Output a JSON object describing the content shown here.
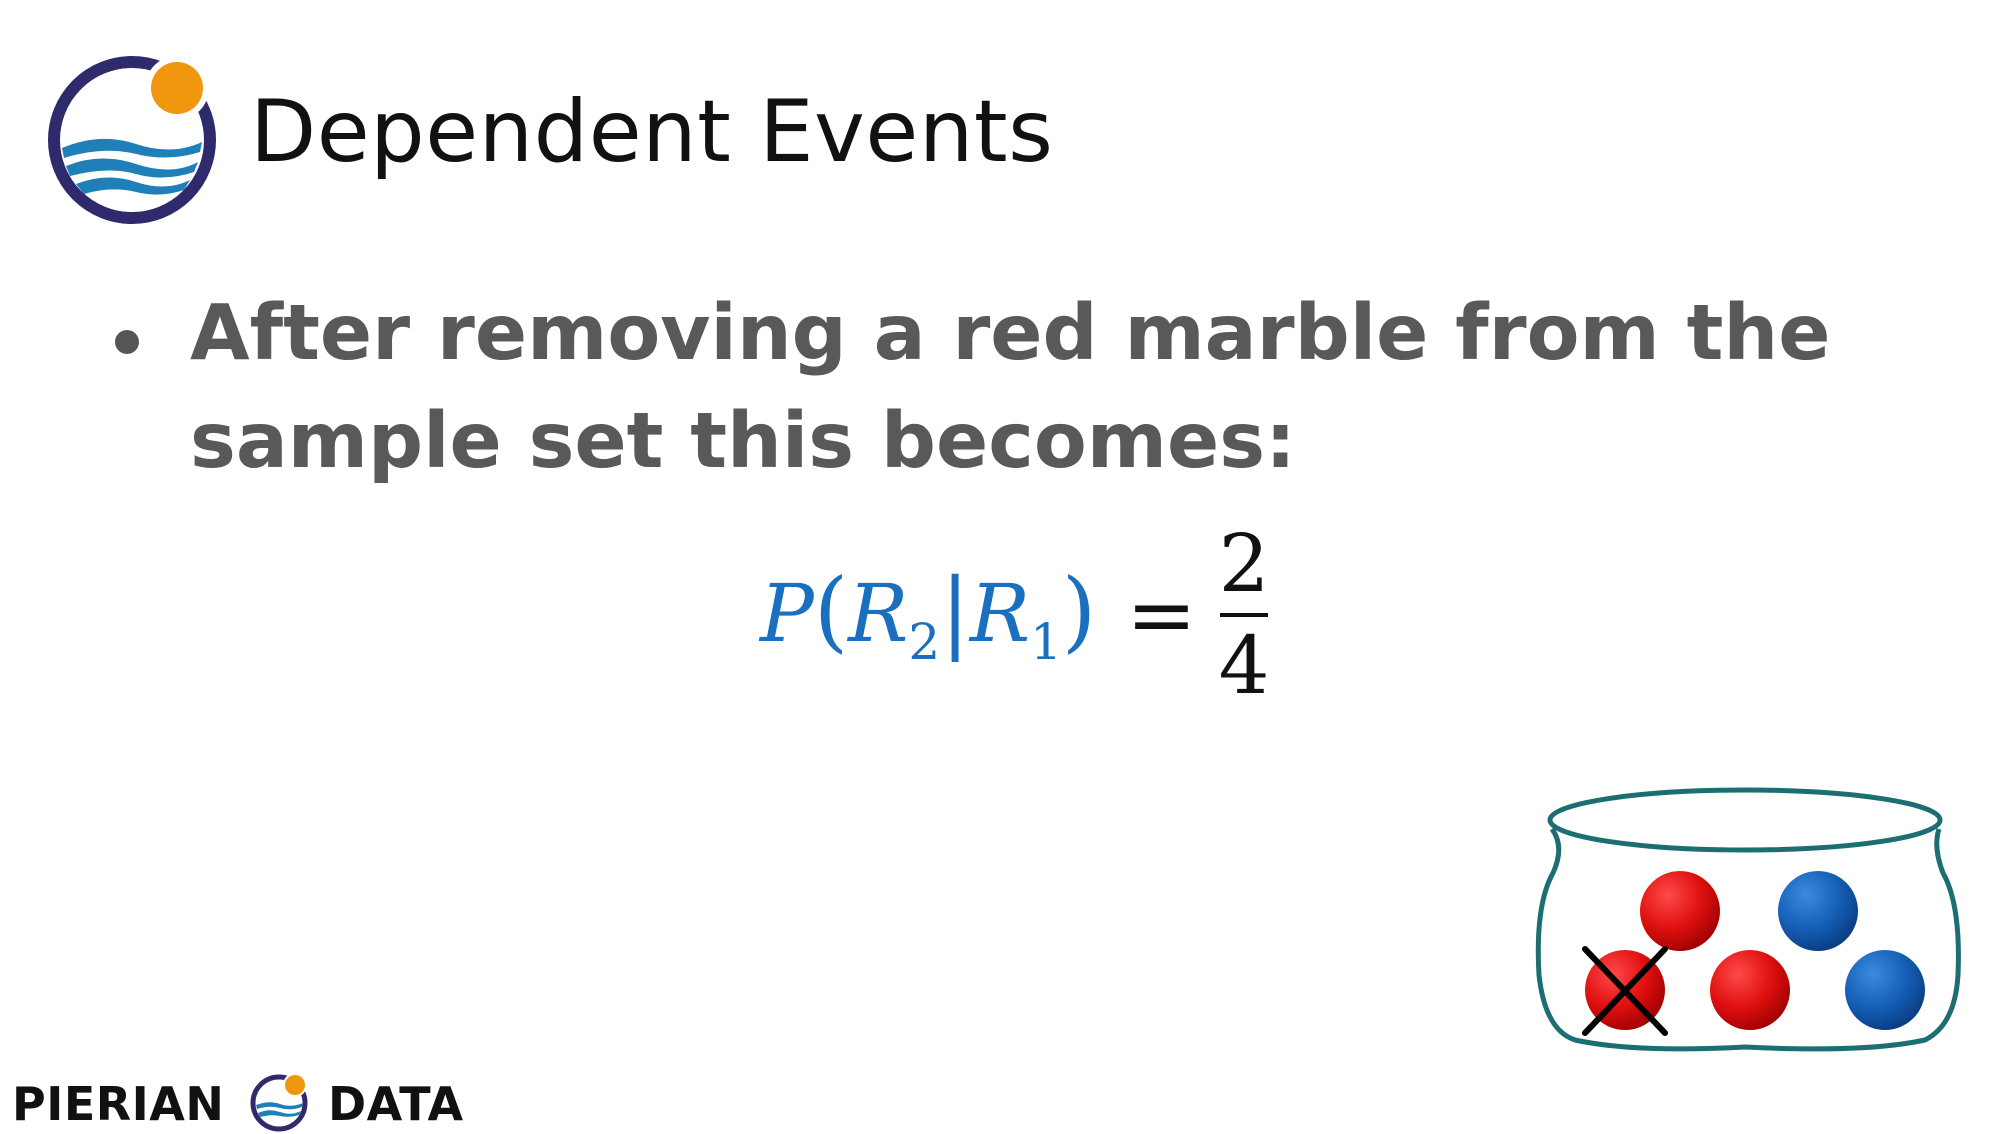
{
  "slide": {
    "title": "Dependent Events",
    "bullet_lines": [
      "After removing a red marble from the",
      "sample set this becomes:"
    ]
  },
  "formula": {
    "P": "P",
    "open_paren": "(",
    "R2_letter": "R",
    "R2_sub": "2",
    "pipe": "|",
    "R1_letter": "R",
    "R1_sub": "1",
    "close_paren": ")",
    "equals": "=",
    "numerator": "2",
    "denominator": "4"
  },
  "jar": {
    "marbles": [
      {
        "color": "red",
        "removed": false
      },
      {
        "color": "blue",
        "removed": false
      },
      {
        "color": "red",
        "removed": true
      },
      {
        "color": "red",
        "removed": false
      },
      {
        "color": "blue",
        "removed": false
      }
    ]
  },
  "footer": {
    "left_text": "PIERIAN",
    "right_text": "DATA"
  },
  "colors": {
    "title": "#111111",
    "bullet_text": "#595959",
    "formula_blue": "#1a6fbf",
    "logo_ring": "#2e2a6b",
    "logo_sun": "#f0960f",
    "logo_wave": "#1f7fb8",
    "jar_outline": "#1c6e73",
    "marble_red": "#e01010",
    "marble_blue": "#1560b8"
  }
}
